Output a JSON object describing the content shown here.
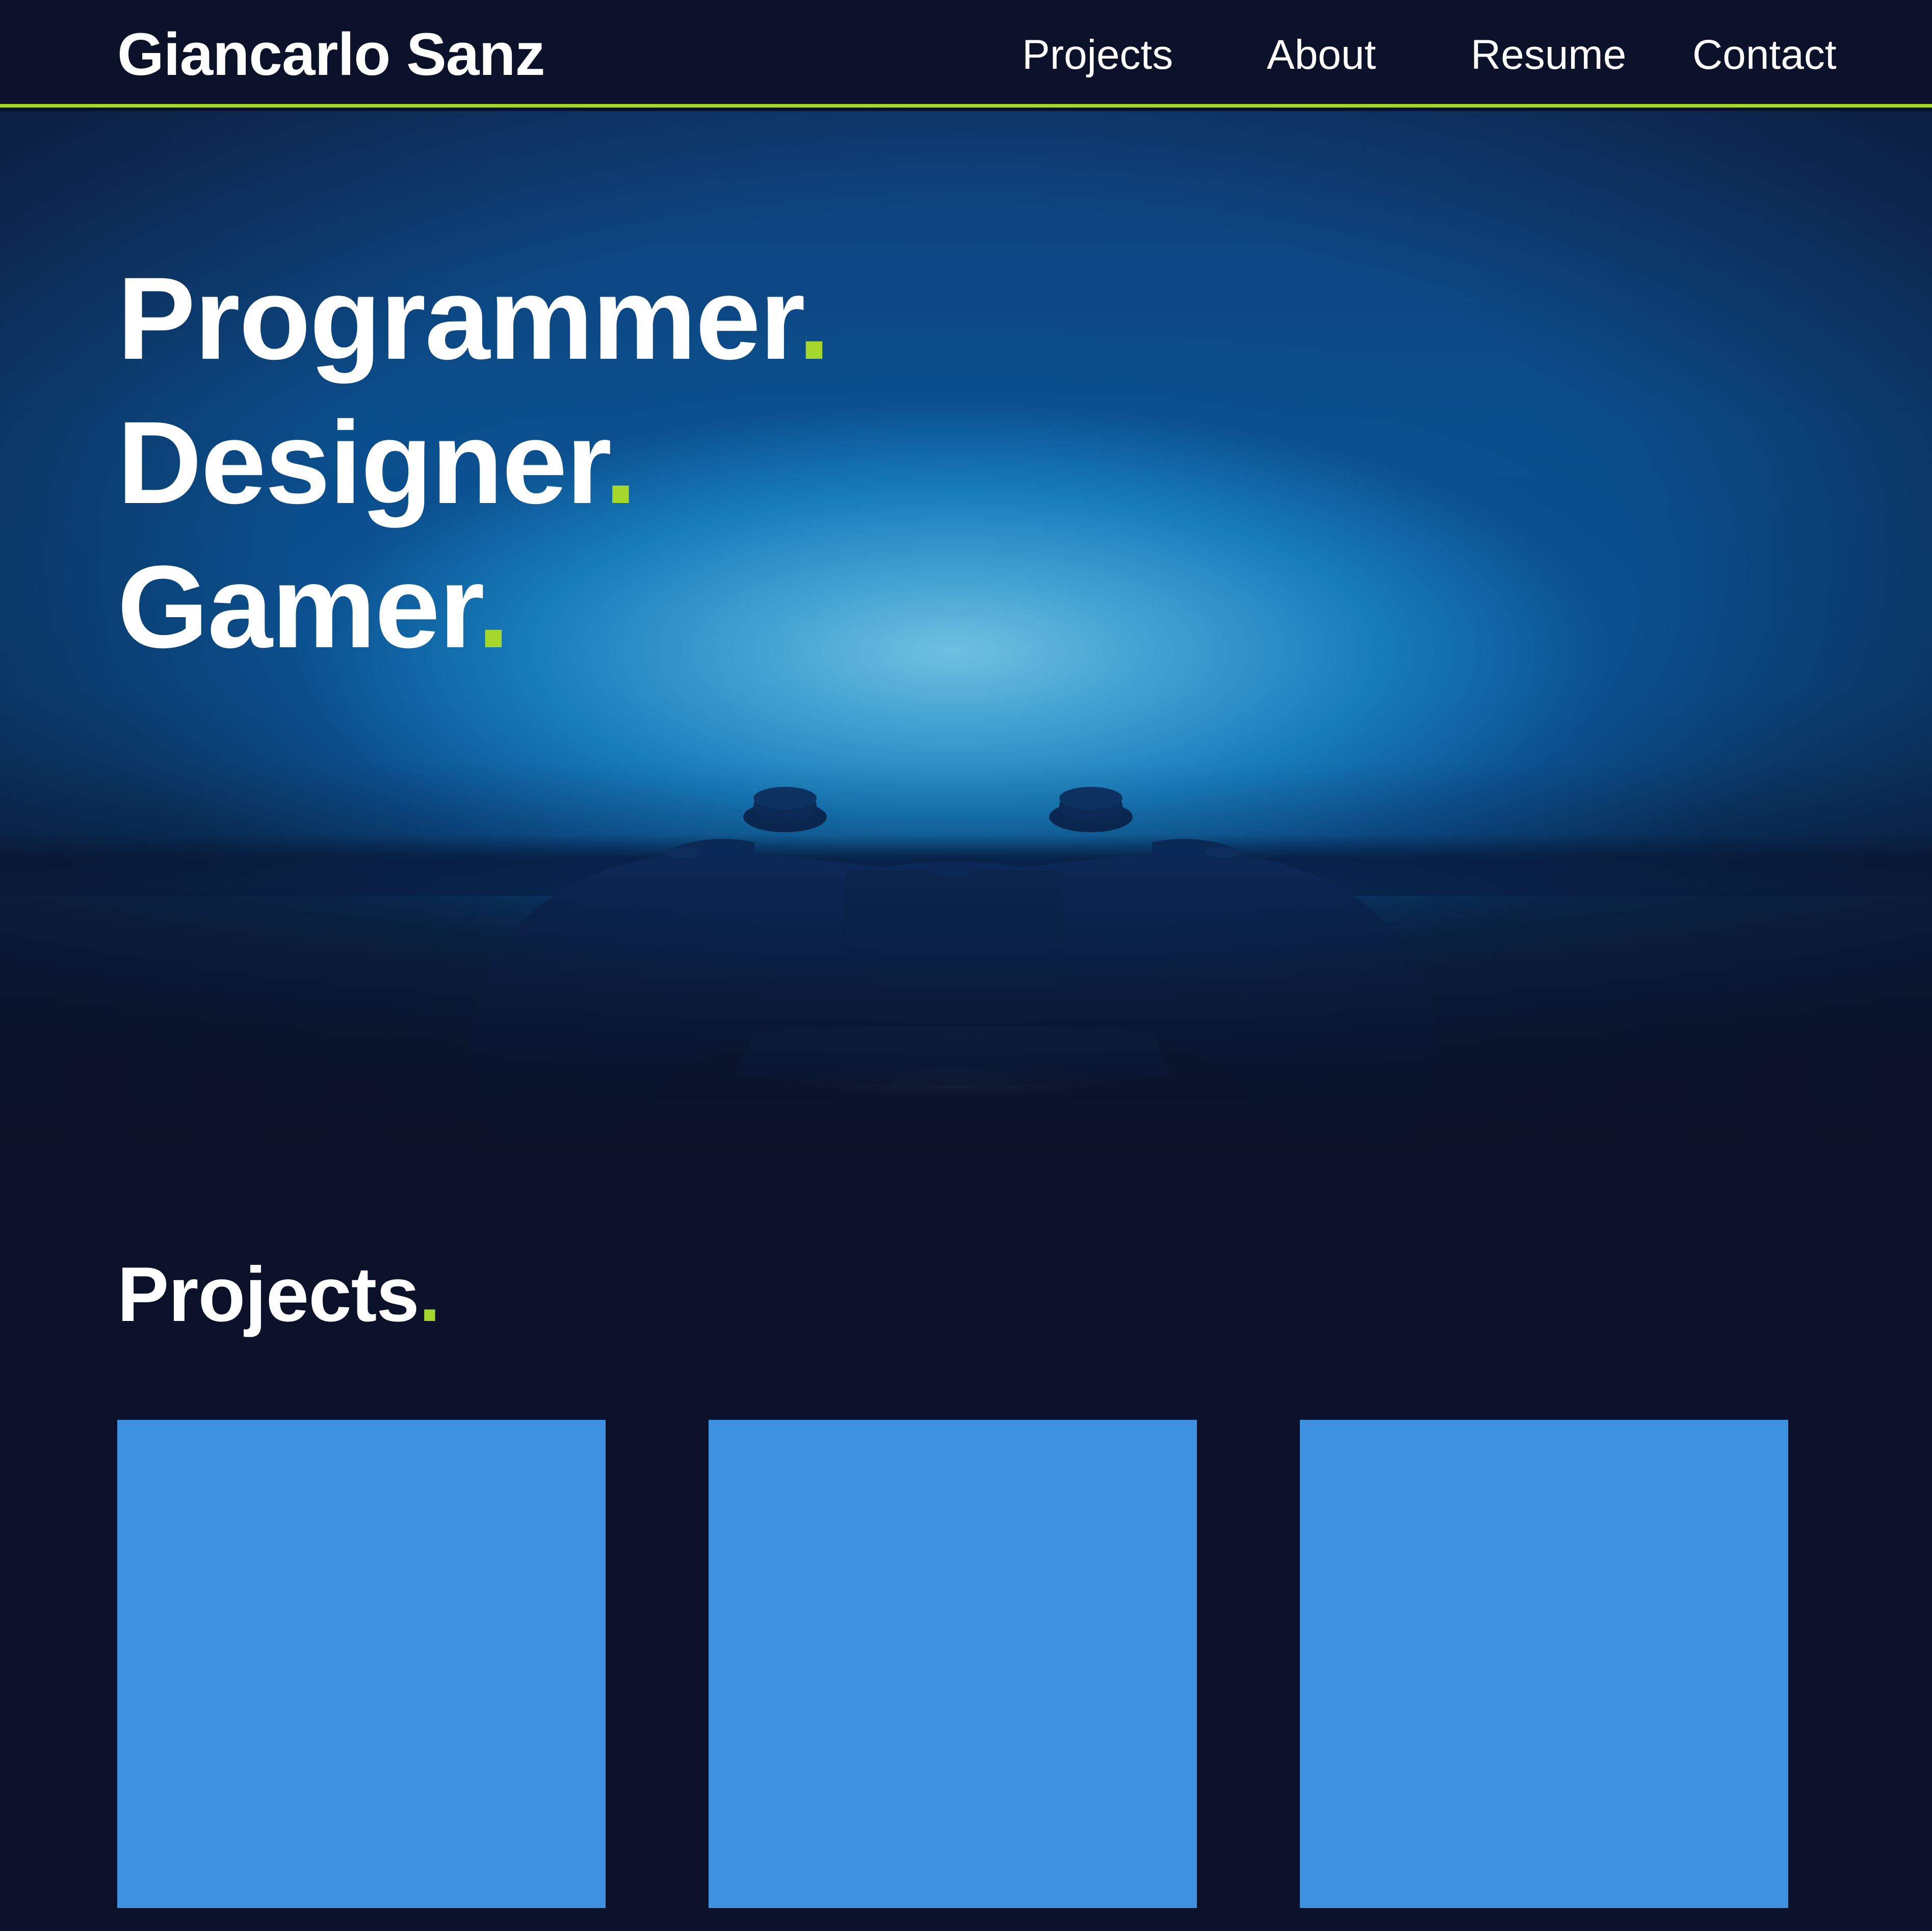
{
  "header": {
    "brand": "Giancarlo Sanz",
    "nav": [
      {
        "label": "Projects"
      },
      {
        "label": "About"
      },
      {
        "label": "Resume"
      },
      {
        "label": "Contact"
      }
    ]
  },
  "hero": {
    "lines": [
      {
        "text": "Programmer",
        "punct": "."
      },
      {
        "text": "Designer",
        "punct": "."
      },
      {
        "text": "Gamer",
        "punct": "."
      }
    ],
    "image": "game-controller-photo"
  },
  "projects": {
    "title": "Projects",
    "title_punct": ".",
    "cards": [
      {
        "name": "project-card-1"
      },
      {
        "name": "project-card-2"
      },
      {
        "name": "project-card-3"
      }
    ]
  },
  "colors": {
    "background": "#0b1128",
    "accent": "#a5d62c",
    "card": "#3e90e0",
    "text": "#ffffff"
  }
}
